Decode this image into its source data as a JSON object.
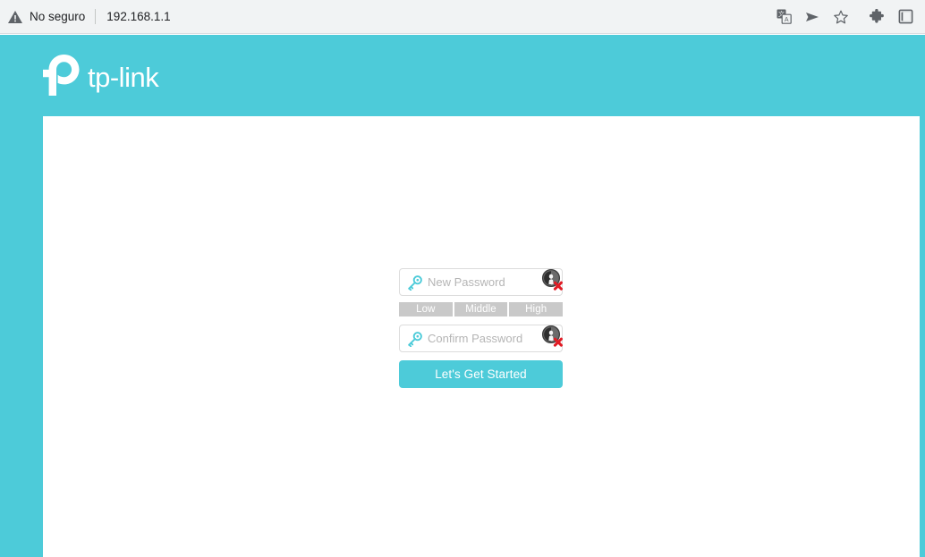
{
  "browser": {
    "security_label": "No seguro",
    "url": "192.168.1.1",
    "icons": {
      "security_warning": "warning-triangle-icon",
      "translate": "translate-icon",
      "send": "send-arrow-icon",
      "bookmark": "star-icon",
      "extensions": "puzzle-piece-icon",
      "panel": "side-panel-icon"
    }
  },
  "brand": {
    "name": "tp-link",
    "logo_alt": "tp-link",
    "accent_color": "#4dcbd9",
    "header_bg": "#4dcbd9"
  },
  "form": {
    "new_password": {
      "placeholder": "New Password",
      "value": "",
      "key_icon": "key-icon",
      "toggle_icon": "hide-password-icon"
    },
    "confirm_password": {
      "placeholder": "Confirm Password",
      "value": "",
      "key_icon": "key-icon",
      "toggle_icon": "hide-password-icon"
    },
    "strength": {
      "segments": [
        "Low",
        "Middle",
        "High"
      ],
      "active": null,
      "inactive_color": "#c9c9c9"
    },
    "submit_label": "Let's Get Started"
  }
}
